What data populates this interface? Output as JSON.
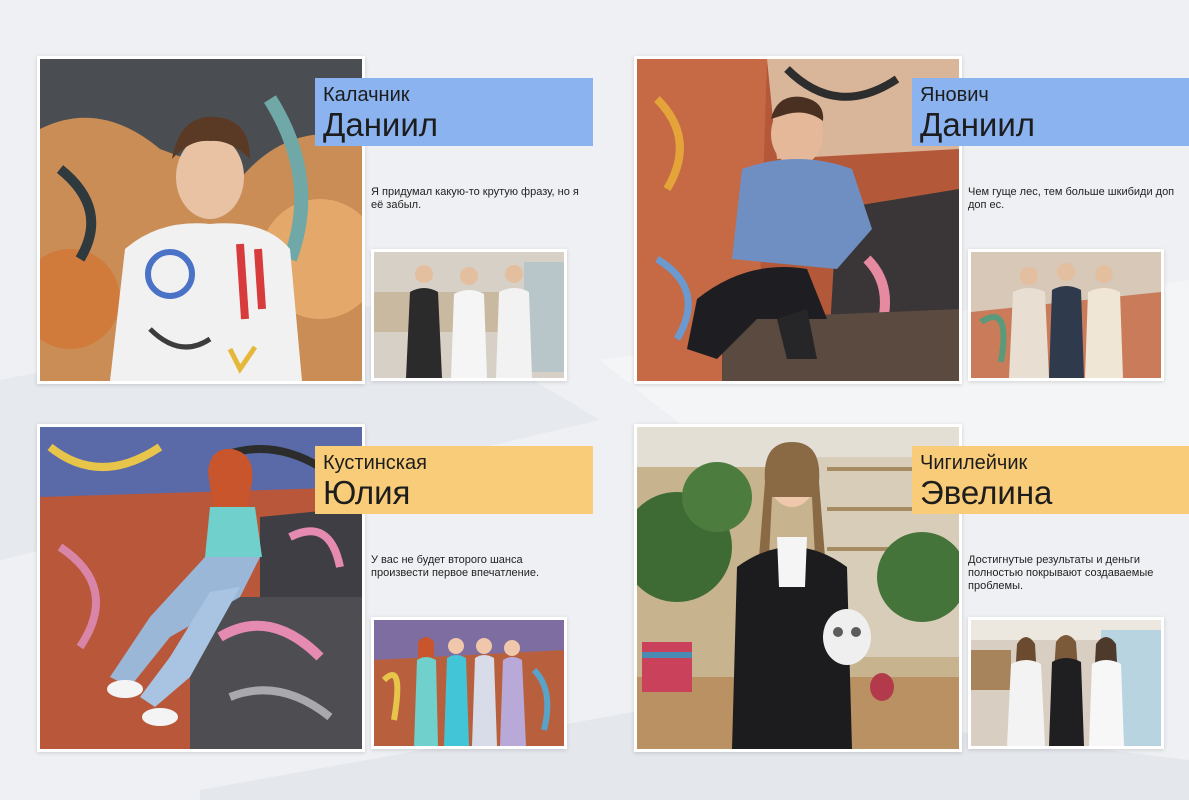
{
  "cards": [
    {
      "surname": "Калачник",
      "firstname": "Даниил",
      "quote": "Я придумал какую-то крутую фразу, но я её забыл.",
      "accent": "#8ab3f0"
    },
    {
      "surname": "Янович",
      "firstname": "Даниил",
      "quote": "Чем гуще лес, тем больше шкибиди доп доп ес.",
      "accent": "#8ab3f0"
    },
    {
      "surname": "Кустинская",
      "firstname": "Юлия",
      "quote": "У вас не будет второго шанса произвести первое впечатление.",
      "accent": "#f8cc79"
    },
    {
      "surname": "Чигилейчик",
      "firstname": "Эвелина",
      "quote": "Достигнутые результаты и деньги полностью покрывают создаваемые проблемы.",
      "accent": "#f8cc79"
    }
  ]
}
